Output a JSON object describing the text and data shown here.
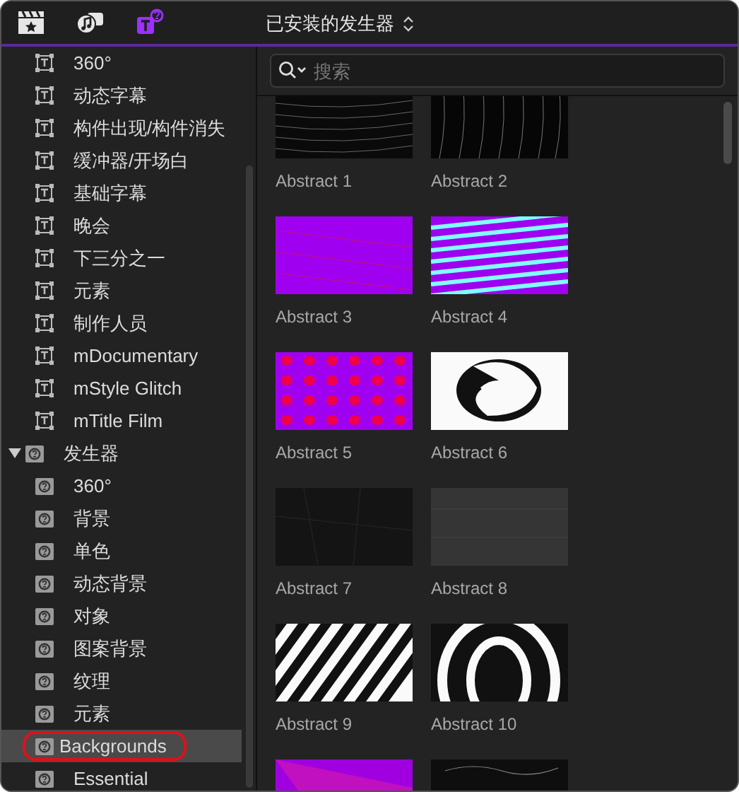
{
  "toolbar": {
    "tabs": [
      {
        "selected": false
      },
      {
        "selected": false
      },
      {
        "selected": true
      }
    ],
    "title": "已安装的发生器"
  },
  "sidebar": {
    "tree": [
      {
        "kind": "title",
        "children": [
          {
            "label": "360°",
            "selected": false
          },
          {
            "label": "动态字幕",
            "selected": false
          },
          {
            "label": "构件出现/构件消失",
            "selected": false
          },
          {
            "label": "缓冲器/开场白",
            "selected": false
          },
          {
            "label": "基础字幕",
            "selected": false
          },
          {
            "label": "晚会",
            "selected": false
          },
          {
            "label": "下三分之一",
            "selected": false
          },
          {
            "label": "元素",
            "selected": false
          },
          {
            "label": "制作人员",
            "selected": false
          },
          {
            "label": "mDocumentary",
            "selected": false
          },
          {
            "label": "mStyle Glitch",
            "selected": false
          },
          {
            "label": "mTitle Film",
            "selected": false
          }
        ]
      },
      {
        "kind": "generator",
        "label": "发生器",
        "expanded": true,
        "children": [
          {
            "label": "360°",
            "selected": false
          },
          {
            "label": "背景",
            "selected": false
          },
          {
            "label": "单色",
            "selected": false
          },
          {
            "label": "动态背景",
            "selected": false
          },
          {
            "label": "对象",
            "selected": false
          },
          {
            "label": "图案背景",
            "selected": false
          },
          {
            "label": "纹理",
            "selected": false
          },
          {
            "label": "元素",
            "selected": false
          },
          {
            "label": "Backgrounds",
            "selected": true
          },
          {
            "label": "Essential",
            "selected": false
          }
        ]
      }
    ]
  },
  "browser": {
    "search": {
      "placeholder": "搜索"
    },
    "items": [
      {
        "kind": "picture",
        "label": "Abstract 1"
      },
      {
        "kind": "picture",
        "label": "Abstract 2"
      },
      {
        "kind": "picture",
        "label": "Abstract 3"
      },
      {
        "kind": "picture",
        "label": "Abstract 4"
      },
      {
        "kind": "picture",
        "label": "Abstract 5"
      },
      {
        "kind": "picture",
        "label": "Abstract 6"
      },
      {
        "kind": "picture",
        "label": "Abstract 7"
      },
      {
        "kind": "picture",
        "label": "Abstract 8"
      },
      {
        "kind": "picture",
        "label": "Abstract 9"
      },
      {
        "kind": "picture",
        "label": "Abstract 10"
      },
      {
        "kind": "picture"
      },
      {
        "kind": "picture"
      }
    ]
  }
}
